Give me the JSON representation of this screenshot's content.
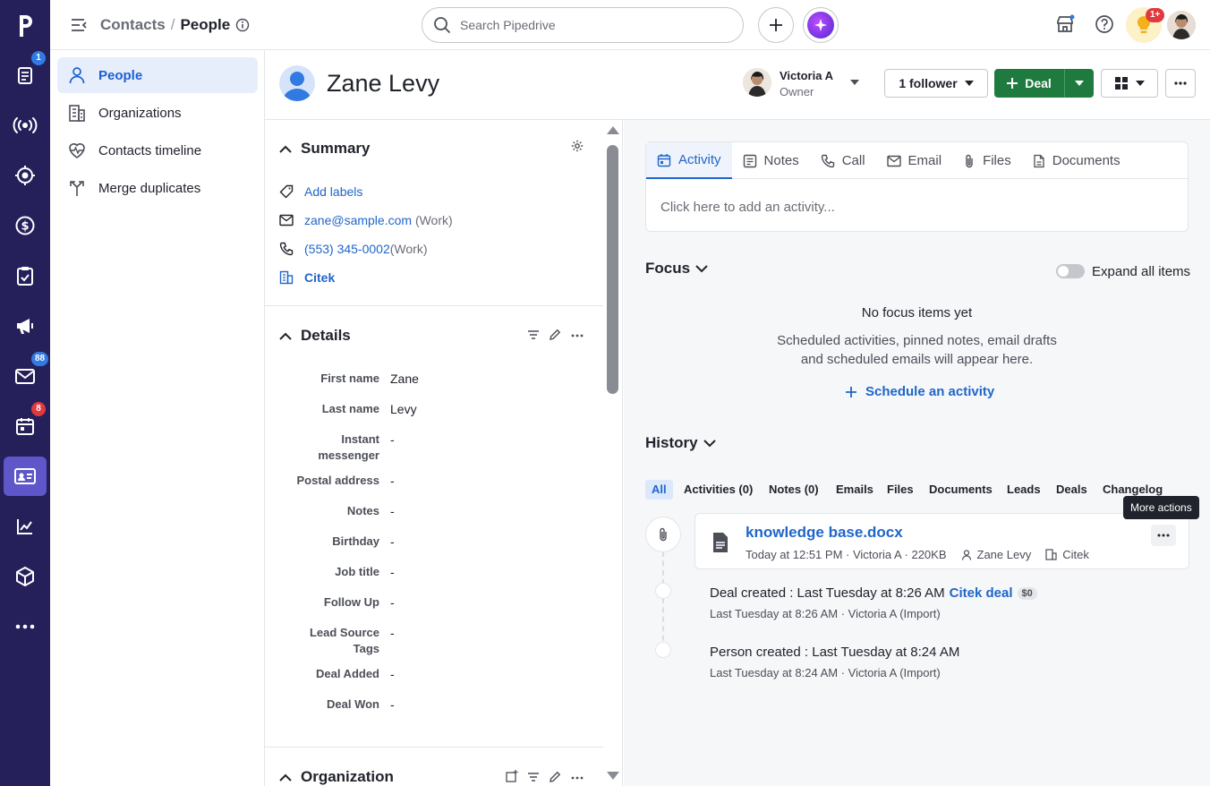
{
  "rail": {
    "items": [
      {
        "icon": "logo-icon",
        "badge": ""
      },
      {
        "icon": "leads-icon",
        "badge": "1"
      },
      {
        "icon": "broadcast-icon",
        "badge": ""
      },
      {
        "icon": "target-icon",
        "badge": ""
      },
      {
        "icon": "deals-icon",
        "badge": ""
      },
      {
        "icon": "tasks-icon",
        "badge": ""
      },
      {
        "icon": "campaigns-icon",
        "badge": ""
      },
      {
        "icon": "mail-icon",
        "badge": "88"
      },
      {
        "icon": "calendar-icon",
        "badge": "8"
      },
      {
        "icon": "contacts-icon",
        "badge": ""
      },
      {
        "icon": "insights-icon",
        "badge": ""
      },
      {
        "icon": "products-icon",
        "badge": ""
      },
      {
        "icon": "more-icon",
        "badge": ""
      }
    ]
  },
  "topbar": {
    "crumb_parent": "Contacts",
    "crumb_sep": "/",
    "crumb_current": "People",
    "search_placeholder": "Search Pipedrive",
    "notif_badge": "1+"
  },
  "subnav": {
    "items": [
      {
        "label": "People"
      },
      {
        "label": "Organizations"
      },
      {
        "label": "Contacts timeline"
      },
      {
        "label": "Merge duplicates"
      }
    ]
  },
  "person": {
    "name": "Zane Levy",
    "owner_name": "Victoria A",
    "owner_role": "Owner",
    "follower_label": "1 follower",
    "deal_label": "Deal"
  },
  "summary": {
    "title": "Summary",
    "add_labels": "Add labels",
    "email": "zane@sample.com",
    "email_type": "(Work)",
    "phone": "(553) 345-0002",
    "phone_type": "(Work)",
    "org": "Citek"
  },
  "details": {
    "title": "Details",
    "rows": [
      {
        "label": "First name",
        "value": "Zane"
      },
      {
        "label": "Last name",
        "value": "Levy"
      },
      {
        "label": "Instant messenger",
        "value": "-"
      },
      {
        "label": "Postal address",
        "value": "-"
      },
      {
        "label": "Notes",
        "value": "-"
      },
      {
        "label": "Birthday",
        "value": "-"
      },
      {
        "label": "Job title",
        "value": "-"
      },
      {
        "label": "Follow Up",
        "value": "-"
      },
      {
        "label": "Lead Source Tags",
        "value": "-"
      },
      {
        "label": "Deal Added",
        "value": "-"
      },
      {
        "label": "Deal Won",
        "value": "-"
      }
    ]
  },
  "organization": {
    "title": "Organization"
  },
  "composer": {
    "tabs": [
      {
        "label": "Activity"
      },
      {
        "label": "Notes"
      },
      {
        "label": "Call"
      },
      {
        "label": "Email"
      },
      {
        "label": "Files"
      },
      {
        "label": "Documents"
      }
    ],
    "placeholder": "Click here to add an activity..."
  },
  "focus": {
    "title": "Focus",
    "expand_label": "Expand all items",
    "empty_title": "No focus items yet",
    "empty_line1": "Scheduled activities, pinned notes, email drafts",
    "empty_line2": "and scheduled emails will appear here.",
    "schedule_label": "Schedule an activity"
  },
  "history": {
    "title": "History",
    "tabs": [
      "All",
      "Activities (0)",
      "Notes (0)",
      "Emails",
      "Files",
      "Documents",
      "Leads",
      "Deals",
      "Changelog"
    ],
    "tooltip": "More actions",
    "file": {
      "name": "knowledge base.docx",
      "meta": "Today at 12:51 PM · Victoria A · 220KB",
      "person": "Zane Levy",
      "org": "Citek"
    },
    "events": [
      {
        "text": "Deal created : Last Tuesday at 8:26 AM",
        "link": "Citek deal",
        "badge": "$0",
        "meta": "Last Tuesday at 8:26 AM · Victoria A (Import)"
      },
      {
        "text": "Person created : Last Tuesday at 8:24 AM",
        "link": "",
        "badge": "",
        "meta": "Last Tuesday at 8:24 AM · Victoria A (Import)"
      }
    ]
  }
}
